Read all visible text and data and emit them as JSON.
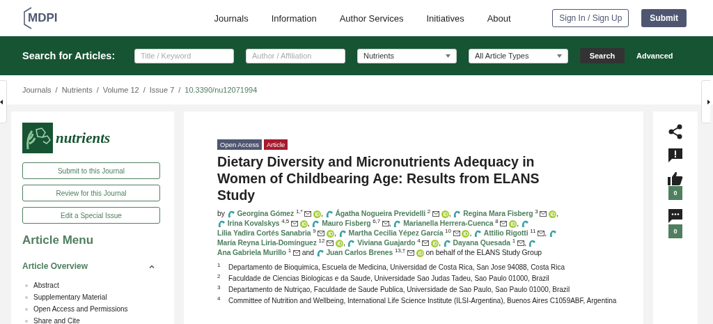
{
  "header": {
    "logo": "MDPI",
    "nav": [
      "Journals",
      "Information",
      "Author Services",
      "Initiatives",
      "About"
    ],
    "sign_in": "Sign In / Sign Up",
    "submit": "Submit"
  },
  "search": {
    "label": "Search for Articles:",
    "fields": [
      {
        "kind": "input",
        "placeholder": "Title / Keyword"
      },
      {
        "kind": "input",
        "placeholder": "Author / Affiliation"
      },
      {
        "kind": "select",
        "value": "Nutrients"
      },
      {
        "kind": "select",
        "value": "All Article Types"
      }
    ],
    "button": "Search",
    "advanced": "Advanced"
  },
  "breadcrumb": [
    {
      "label": "Journals",
      "link": false
    },
    {
      "sep": "/",
      "label": "Nutrients",
      "link": false
    },
    {
      "sep": "/",
      "label": "Volume 12",
      "link": false
    },
    {
      "sep": "/",
      "label": "Issue 7",
      "link": false
    },
    {
      "sep": "/",
      "label": "10.3390/nu12071994",
      "link": true
    }
  ],
  "sidebar": {
    "journal": "nutrients",
    "buttons": [
      "Submit to this Journal",
      "Review for this Journal",
      "Edit a Special Issue"
    ],
    "menu_title": "Article Menu",
    "section": {
      "title": "Article Overview",
      "expanded": true,
      "items": [
        "Abstract",
        "Supplementary Material",
        "Open Access and Permissions",
        "Share and Cite"
      ]
    }
  },
  "article": {
    "badges": [
      {
        "label": "Open Access",
        "color": "#4f5671"
      },
      {
        "label": "Article",
        "color": "#a6192e"
      }
    ],
    "title": "Dietary Diversity and Micronutrients Adequacy in Women of Childbearing Age: Results from ELANS Study",
    "prefix": "by",
    "suffix": "on behalf of the ELANS Study Group",
    "authors": [
      {
        "name": "Georgina Gómez",
        "sup": "1,*",
        "email": true,
        "orcid": true,
        "sep": ","
      },
      {
        "name": "Ágatha Nogueira Previdelli",
        "sup": "2",
        "email": true,
        "orcid": true,
        "sep": ","
      },
      {
        "name": "Regina Mara Fisberg",
        "sup": "3",
        "email": true,
        "orcid": true,
        "sep": ","
      },
      {
        "name": "Irina Kovalskys",
        "sup": "4,5",
        "email": true,
        "orcid": true,
        "sep": ","
      },
      {
        "name": "Mauro Fisberg",
        "sup": "6,7",
        "email": true,
        "orcid": false,
        "sep": ","
      },
      {
        "name": "Marianella Herrera-Cuenca",
        "sup": "8",
        "email": true,
        "orcid": true,
        "sep": ","
      },
      {
        "name": "Lilia Yadira Cortés Sanabria",
        "sup": "9",
        "email": true,
        "orcid": true,
        "sep": ","
      },
      {
        "name": "Martha Cecilia Yépez García",
        "sup": "10",
        "email": true,
        "orcid": true,
        "sep": ","
      },
      {
        "name": "Attilio Rigotti",
        "sup": "11",
        "email": true,
        "orcid": false,
        "sep": ","
      },
      {
        "name": "María Reyna Liria-Domínguez",
        "sup": "12",
        "email": true,
        "orcid": true,
        "sep": ","
      },
      {
        "name": "Viviana Guajardo",
        "sup": "4",
        "email": true,
        "orcid": true,
        "sep": ","
      },
      {
        "name": "Dayana Quesada",
        "sup": "1",
        "email": true,
        "orcid": false,
        "sep": ","
      },
      {
        "name": "Ana Gabriela Murillo",
        "sup": "1",
        "email": true,
        "orcid": false,
        "sep": "and"
      },
      {
        "name": "Juan Carlos Brenes",
        "sup": "13,†",
        "email": true,
        "orcid": true
      }
    ],
    "affiliations": [
      {
        "num": "1",
        "text": "Departamento de Bioquimica, Escuela de Medicina, Universidad de Costa Rica, San Jose 94088, Costa Rica"
      },
      {
        "num": "2",
        "text": "Faculdade de Ciencias Biologicas e da Saude, Universidade Sao Judas Tadeu, Sao Paulo 01000, Brazil"
      },
      {
        "num": "3",
        "text": "Departamento de Nutriçao, Faculdade de Saude Publica, Universidade de Sao Paulo, Sao Paulo 01000, Brazil"
      },
      {
        "num": "4",
        "text": "Committee of Nutrition and Wellbeing, International Life Science Institute (ILSI-Argentina), Buenos Aires C1059ABF, Argentina"
      }
    ]
  },
  "actions": [
    {
      "kind": "share"
    },
    {
      "kind": "report"
    },
    {
      "kind": "like",
      "count": "0"
    },
    {
      "kind": "comment",
      "count": "0"
    }
  ]
}
